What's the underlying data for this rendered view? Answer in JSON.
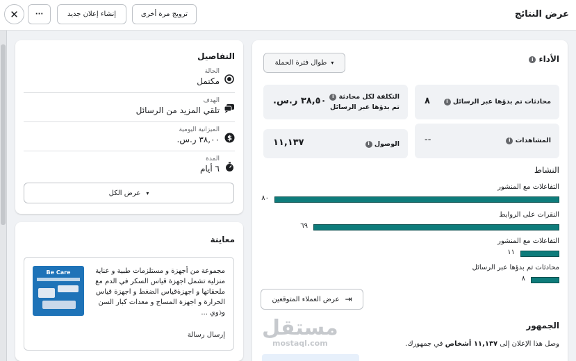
{
  "header": {
    "title": "عرض النتائج",
    "promote_again": "ترويج مرة أخرى",
    "create_ad": "إنشاء إعلان جديد",
    "more": "···",
    "close": "✕"
  },
  "performance": {
    "title": "الأداء",
    "dropdown": "طوال فترة الحملة",
    "metrics": {
      "conversations_label": "محادثات تم بدؤها عبر الرسائل",
      "conversations_value": "٨",
      "cost_label_1": "التكلفة لكل محادثة",
      "cost_label_2": "تم بدؤها عبر الرسائل",
      "cost_value": "٣٨,٥٠ ر.س.",
      "views_label": "المشاهدات",
      "views_value": "--",
      "reach_label": "الوصول",
      "reach_value": "١١,١٣٧"
    }
  },
  "activity": {
    "title": "النشاط",
    "items": [
      {
        "label": "التفاعلات مع المنشور",
        "value": "٨٠",
        "fraction": 1.0
      },
      {
        "label": "النقرات على الروابط",
        "value": "٦٩",
        "fraction": 0.8625
      },
      {
        "label": "التفاعلات مع المنشور",
        "value": "١١",
        "fraction": 0.1375
      },
      {
        "label": "محادثات تم بدؤها عبر الرسائل",
        "value": "٨",
        "fraction": 0.1
      }
    ],
    "audience_button": "عرض العملاء المتوقعين"
  },
  "audience": {
    "title": "الجمهور",
    "text_prefix": "وصل هذا الإعلان إلى",
    "text_bold": "١١,١٣٧ أشخاص",
    "text_suffix": "في جمهورك."
  },
  "watermark": {
    "line1": "مستقل",
    "line2": "mostaql.com"
  },
  "details": {
    "title": "التفاصيل",
    "rows": [
      {
        "label": "الحالة",
        "value": "مكتمل",
        "icon": "status-icon"
      },
      {
        "label": "الهدف",
        "value": "تلقي المزيد من الرسائل",
        "icon": "chat-icon"
      },
      {
        "label": "الميزانية اليومية",
        "value": "٣٨,٠٠ ر.س.",
        "icon": "dollar-icon"
      },
      {
        "label": "المدة",
        "value": "٦ أيام",
        "icon": "stopwatch-icon"
      }
    ],
    "view_all": "عرض الكل"
  },
  "preview": {
    "title": "معاينة",
    "text": "مجموعة من أجهزة و مستلزمات طبية و عناية منزلية تشمل اجهزة قياس السكر في الدم مع ملحقاتها و اجهزةقياس الضغط و اجهزة قياس الحرارة و اجهزة المساج و معدات كبار السن وذوي ...",
    "cta": "إرسال رسالة",
    "image_brand": "Be Care",
    "image_tagline": "BECAUSE WE CARE"
  }
}
